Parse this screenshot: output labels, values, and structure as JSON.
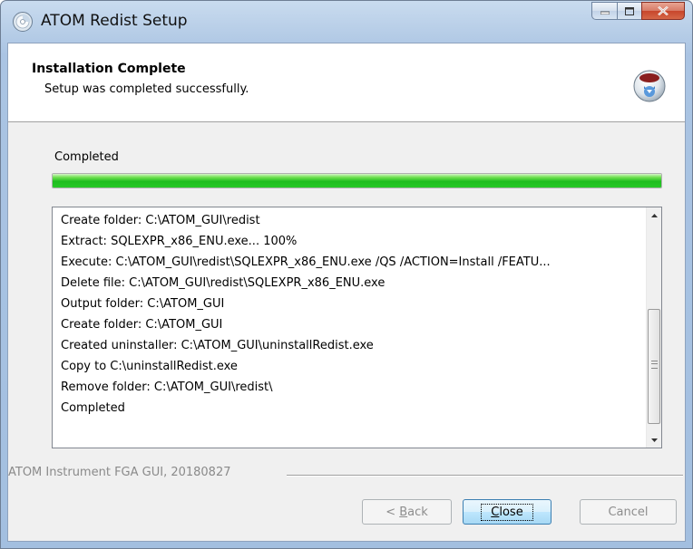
{
  "window": {
    "title": "ATOM Redist Setup",
    "icon": "setup-disc-icon",
    "caption_buttons": [
      "minimize",
      "maximize",
      "close"
    ]
  },
  "header": {
    "title": "Installation Complete",
    "subtitle": "Setup was completed successfully.",
    "icon": "nsis-installer-icon"
  },
  "status": {
    "label": "Completed",
    "progress_fraction": 1.0,
    "progress_color": "#27c927"
  },
  "log": {
    "lines": [
      "Create folder: C:\\ATOM_GUI\\redist",
      "Extract: SQLEXPR_x86_ENU.exe... 100%",
      "Execute: C:\\ATOM_GUI\\redist\\SQLEXPR_x86_ENU.exe /QS /ACTION=Install /FEATU...",
      "Delete file: C:\\ATOM_GUI\\redist\\SQLEXPR_x86_ENU.exe",
      "Output folder: C:\\ATOM_GUI",
      "Create folder: C:\\ATOM_GUI",
      "Created uninstaller: C:\\ATOM_GUI\\uninstallRedist.exe",
      "Copy to C:\\uninstallRedist.exe",
      "Remove folder: C:\\ATOM_GUI\\redist\\",
      "Completed"
    ]
  },
  "branding": "ATOM Instrument FGA GUI, 20180827",
  "buttons": {
    "back": {
      "prefix": "< ",
      "accel": "B",
      "rest": "ack"
    },
    "close": {
      "accel": "C",
      "rest": "lose"
    },
    "cancel": "Cancel"
  }
}
